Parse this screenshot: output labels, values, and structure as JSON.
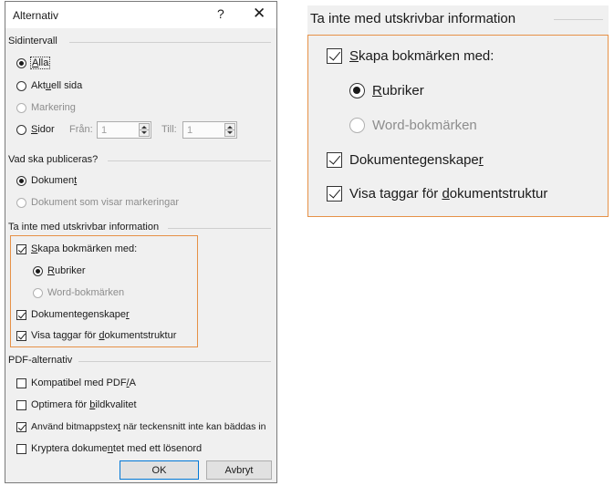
{
  "dialog": {
    "title": "Alternativ",
    "help_glyph": "?",
    "close_glyph": "✕",
    "page_range": {
      "heading": "Sidintervall",
      "all": [
        "",
        "A",
        "lla"
      ],
      "current": [
        "Akt",
        "u",
        "ell sida"
      ],
      "selection": "Markering",
      "pages": [
        "",
        "S",
        "idor"
      ],
      "from_label": "Från:",
      "from_value": "1",
      "to_label": "Till:",
      "to_value": "1"
    },
    "publish": {
      "heading": "Vad ska publiceras?",
      "document": [
        "Dokumen",
        "t",
        ""
      ],
      "document_markup": "Dokument som visar markeringar"
    },
    "non_printable": {
      "heading": "Ta inte med utskrivbar information",
      "bookmarks": [
        "",
        "S",
        "kapa bokmärken med:"
      ],
      "headings": [
        "",
        "R",
        "ubriker"
      ],
      "word_bookmarks": "Word-bokmärken",
      "doc_properties": [
        "Dokumentegenskape",
        "r",
        ""
      ],
      "structure_tags": [
        "Visa taggar för ",
        "d",
        "okumentstruktur"
      ]
    },
    "pdf": {
      "heading": "PDF-alternativ",
      "pdfa": [
        "Kompatibel med PDF",
        "/",
        "A"
      ],
      "optimize": [
        "Optimera för ",
        "b",
        "ildkvalitet"
      ],
      "bitmap": [
        "Använd bitmappstex",
        "t",
        " när teckensnitt inte kan bäddas in"
      ],
      "encrypt": [
        "Kryptera dokume",
        "n",
        "tet med ett lösenord"
      ]
    },
    "ok_label": "OK",
    "cancel_label": "Avbryt"
  },
  "zoom": {
    "heading": "Ta inte med utskrivbar information",
    "bookmarks": [
      "",
      "S",
      "kapa bokmärken med:"
    ],
    "headings": [
      "",
      "R",
      "ubriker"
    ],
    "word_bookmarks": "Word-bokmärken",
    "doc_properties": [
      "Dokumentegenskape",
      "r",
      ""
    ],
    "structure_tags": [
      "Visa taggar för ",
      "d",
      "okumentstruktur"
    ]
  },
  "colors": {
    "highlight": "#e69147",
    "primary_button_border": "#0078d7",
    "dialog_bg": "#f0f0f0"
  }
}
